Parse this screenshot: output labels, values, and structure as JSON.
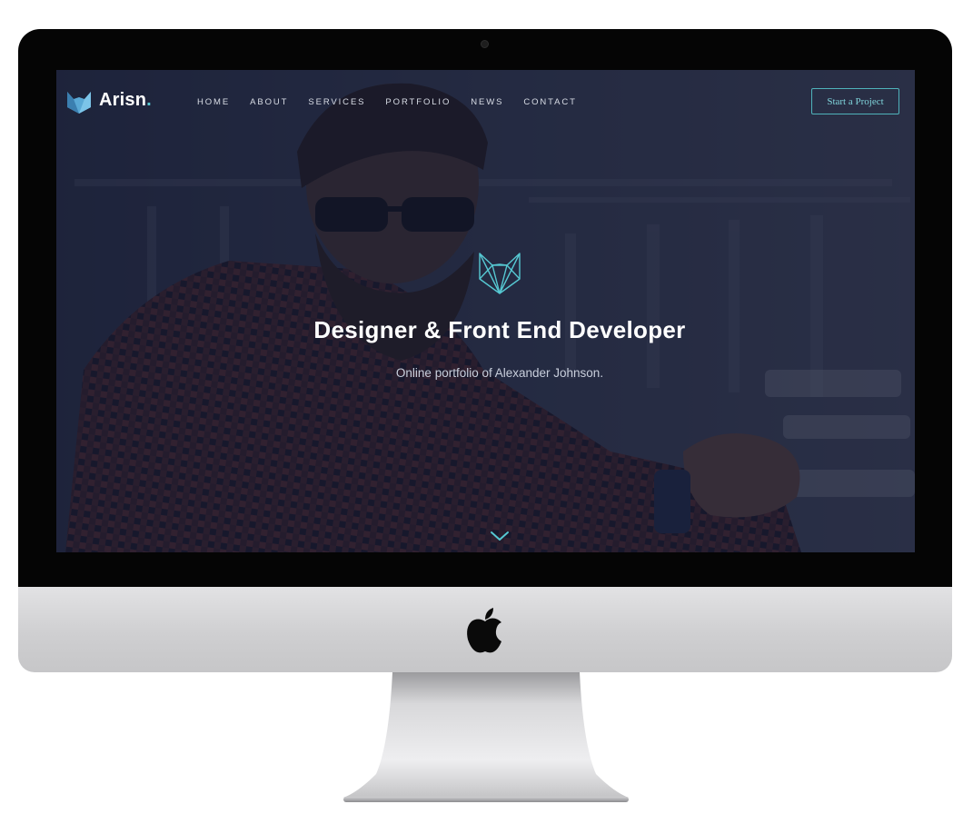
{
  "site": {
    "brand": {
      "name": "Arisn",
      "dot": ".",
      "logo_icon": "fox-logo-icon"
    },
    "nav": {
      "items": [
        {
          "label": "HOME"
        },
        {
          "label": "ABOUT"
        },
        {
          "label": "SERVICES"
        },
        {
          "label": "PORTFOLIO"
        },
        {
          "label": "NEWS"
        },
        {
          "label": "CONTACT"
        }
      ],
      "cta_label": "Start a Project"
    },
    "hero": {
      "emblem_icon": "geometric-fox-emblem-icon",
      "title": "Designer & Front End Developer",
      "subtitle": "Online portfolio of Alexander Johnson.",
      "scroll_icon": "chevron-down-icon"
    }
  },
  "device": {
    "type": "iMac monitor mockup",
    "logo_icon": "apple-logo-icon"
  },
  "colors": {
    "accent": "#56c8d2",
    "overlay": "#161c34",
    "bezel": "#050505",
    "chin": "#d4d4d6"
  }
}
